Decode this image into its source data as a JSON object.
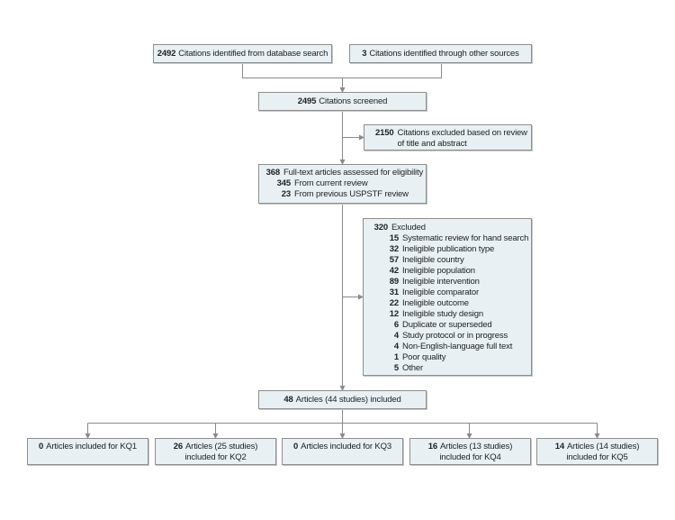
{
  "identification": {
    "database": {
      "count": "2492",
      "label": "Citations identified from database search"
    },
    "other": {
      "count": "3",
      "label": "Citations identified through other sources"
    }
  },
  "screened": {
    "count": "2495",
    "label": "Citations screened"
  },
  "excluded_title_abstract": {
    "count": "2150",
    "label_line1": "Citations excluded based on review",
    "label_line2": "of title and abstract"
  },
  "fulltext": {
    "count": "368",
    "label": "Full-text articles assessed for eligibility",
    "sub": [
      {
        "count": "345",
        "label": "From current review"
      },
      {
        "count": "23",
        "label": "From previous USPSTF review"
      }
    ]
  },
  "excluded_fulltext": {
    "count": "320",
    "label": "Excluded",
    "reasons": [
      {
        "count": "15",
        "label": "Systematic review for hand search"
      },
      {
        "count": "32",
        "label": "Ineligible publication type"
      },
      {
        "count": "57",
        "label": "Ineligible country"
      },
      {
        "count": "42",
        "label": "Ineligible population"
      },
      {
        "count": "89",
        "label": "Ineligible intervention"
      },
      {
        "count": "31",
        "label": "Ineligible comparator"
      },
      {
        "count": "22",
        "label": "Ineligible outcome"
      },
      {
        "count": "12",
        "label": "Ineligible study design"
      },
      {
        "count": "6",
        "label": "Duplicate or superseded"
      },
      {
        "count": "4",
        "label": "Study protocol or in progress"
      },
      {
        "count": "4",
        "label": "Non-English-language full text"
      },
      {
        "count": "1",
        "label": "Poor quality"
      },
      {
        "count": "5",
        "label": "Other"
      }
    ]
  },
  "included": {
    "count": "48",
    "label": "Articles (44 studies) included"
  },
  "key_questions": [
    {
      "count": "0",
      "line1": "Articles included for KQ1",
      "line2": ""
    },
    {
      "count": "26",
      "line1": "Articles (25 studies)",
      "line2": "included for KQ2"
    },
    {
      "count": "0",
      "line1": "Articles included for KQ3",
      "line2": ""
    },
    {
      "count": "16",
      "line1": "Articles (13 studies)",
      "line2": "included for KQ4"
    },
    {
      "count": "14",
      "line1": "Articles (14 studies)",
      "line2": "included for KQ5"
    }
  ],
  "colors": {
    "box_fill": "#e8f0f4",
    "box_border": "#8e8e8e",
    "connector": "#8a8a8a"
  }
}
